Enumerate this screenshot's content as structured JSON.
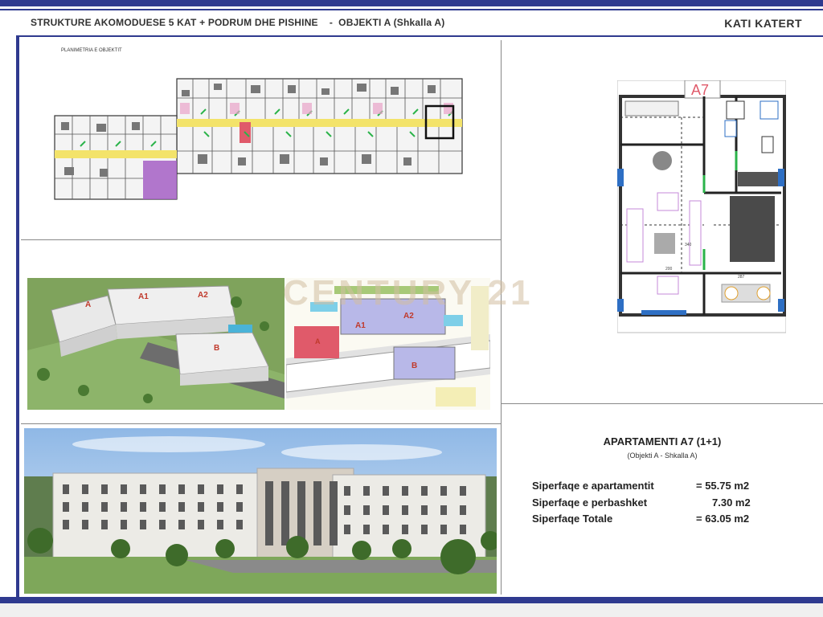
{
  "header": {
    "title": "STRUKTURE AKOMODUESE 5 KAT + PODRUM DHE PISHINE    -  OBJEKTI A (Shkalla A)",
    "floor": "KATI KATERT"
  },
  "site_plan": {
    "label": "PLANIMETRIA E OBJEKTIT"
  },
  "renders": {
    "labels_3d": [
      "A",
      "A1",
      "A2",
      "B"
    ],
    "labels_plan": [
      "A",
      "A1",
      "A2",
      "B"
    ]
  },
  "watermark": "CENTURY 21",
  "unit_plan": {
    "label": "A7",
    "dims": [
      "200",
      "340",
      "287"
    ]
  },
  "apartment": {
    "title": "APARTAMENTI A7 (1+1)",
    "subtitle": "(Objekti A - Shkalla A)",
    "rows": [
      {
        "label": "Siperfaqe e apartamentit",
        "value": "= 55.75 m2"
      },
      {
        "label": "Siperfaqe e perbashket",
        "value": "7.30 m2"
      },
      {
        "label": "Siperfaqe Totale",
        "value": "= 63.05 m2"
      }
    ]
  },
  "colors": {
    "brand_blue": "#2f3a8f",
    "accent_red": "#e05a6a",
    "purple": "#9b59b6"
  }
}
